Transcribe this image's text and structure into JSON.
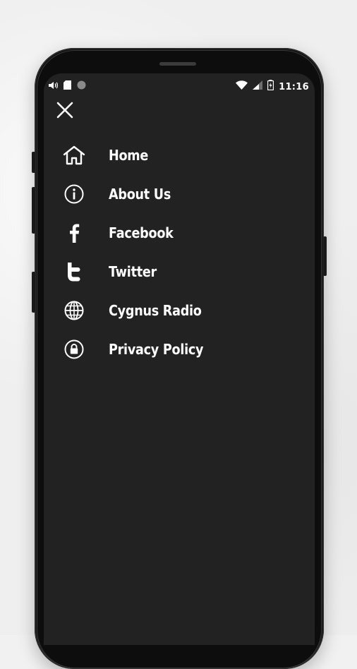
{
  "status_bar": {
    "time": "11:16",
    "icons": [
      "volume-icon",
      "sd-card-icon",
      "dot-icon",
      "wifi-icon",
      "signal-icon",
      "battery-icon"
    ]
  },
  "close_button": {
    "icon": "close-icon"
  },
  "menu": {
    "items": [
      {
        "label": "Home",
        "icon": "home-icon"
      },
      {
        "label": "About Us",
        "icon": "info-icon"
      },
      {
        "label": "Facebook",
        "icon": "facebook-icon"
      },
      {
        "label": "Twitter",
        "icon": "twitter-icon"
      },
      {
        "label": "Cygnus Radio",
        "icon": "globe-icon"
      },
      {
        "label": "Privacy Policy",
        "icon": "lock-icon"
      }
    ]
  },
  "colors": {
    "screen_bg": "#222222",
    "text": "#ffffff",
    "page_bg": "#efefef"
  }
}
